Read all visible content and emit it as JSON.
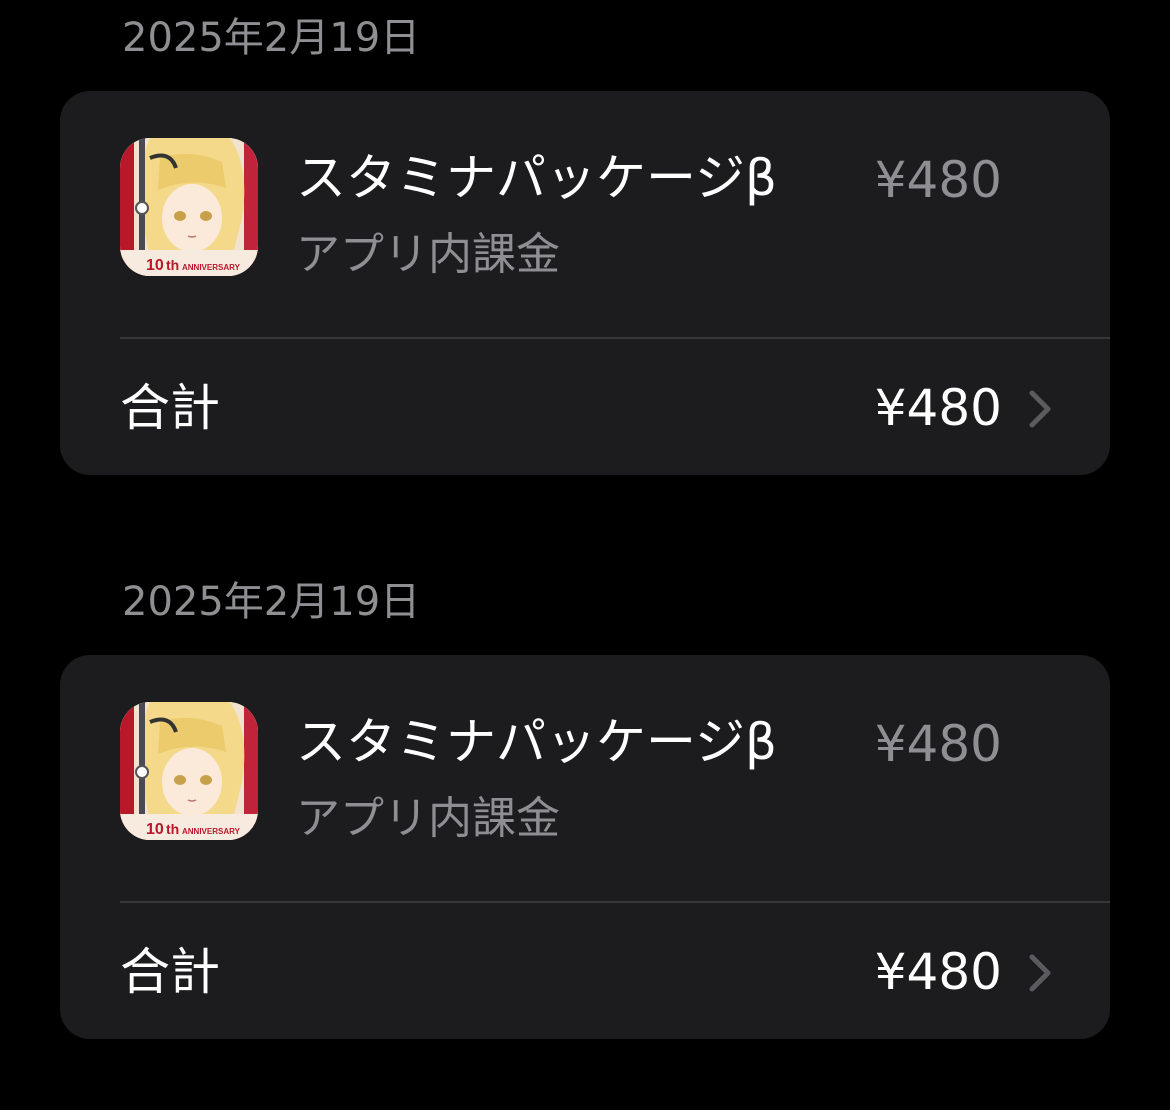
{
  "purchases": [
    {
      "date": "2025年2月19日",
      "item": {
        "title": "スタミナパッケージβ",
        "subtitle": "アプリ内課金",
        "price": "¥480",
        "icon": "app-icon-anime-character",
        "icon_caption": "th ANNIVERSARY"
      },
      "total_label": "合計",
      "total_value": "¥480"
    },
    {
      "date": "2025年2月19日",
      "item": {
        "title": "スタミナパッケージβ",
        "subtitle": "アプリ内課金",
        "price": "¥480",
        "icon": "app-icon-anime-character",
        "icon_caption": "th ANNIVERSARY"
      },
      "total_label": "合計",
      "total_value": "¥480"
    }
  ],
  "colors": {
    "background": "#000000",
    "card": "#1c1c1e",
    "primary_text": "#ffffff",
    "secondary_text": "#8e8e93",
    "divider": "#38383a"
  }
}
